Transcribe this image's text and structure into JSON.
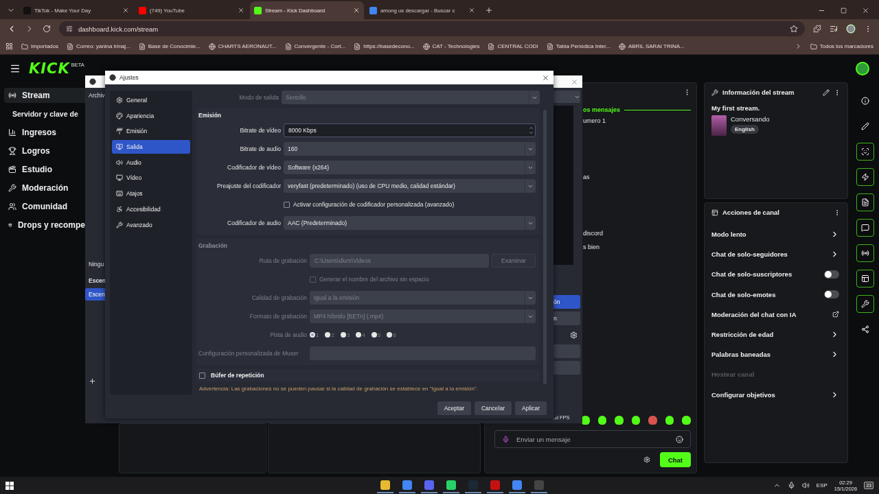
{
  "browser": {
    "tabs": [
      {
        "title": "TikTok - Make Your Day",
        "selected": false
      },
      {
        "title": "(749) YouTube",
        "selected": false
      },
      {
        "title": "Stream - Kick Dashboard",
        "selected": true
      },
      {
        "title": "among us descargar - Buscar c",
        "selected": false
      }
    ],
    "url": "dashboard.kick.com/stream",
    "bookmarks": [
      "Importados",
      "Correo: yanina trinaj...",
      "Base de Conocimie...",
      "CHARTS AERONAUT...",
      "Convergente - Cort...",
      "https://basedecono...",
      "CAT - Technologies",
      "CENTRAL CODI",
      "Tabla Periódica Inter...",
      "ABRIL SARAI TRINA..."
    ],
    "all_bookmarks": "Todos los marcadores"
  },
  "kick": {
    "logo": "KICK",
    "logo_badge": "BETA",
    "nav": [
      {
        "label": "Stream",
        "kind": "main",
        "selected": true
      },
      {
        "label": "Servidor y clave de",
        "kind": "sub",
        "selected": false
      },
      {
        "label": "Ingresos",
        "kind": "main",
        "selected": false
      },
      {
        "label": "Logros",
        "kind": "main",
        "selected": false
      },
      {
        "label": "Estudio",
        "kind": "main",
        "selected": false
      },
      {
        "label": "Moderación",
        "kind": "main",
        "selected": false
      },
      {
        "label": "Comunidad",
        "kind": "main",
        "selected": false
      },
      {
        "label": "Drops y recompe",
        "kind": "main",
        "selected": false
      }
    ],
    "chat": {
      "divider": "os mensajes",
      "messages": [
        "umero 1",
        "as",
        "discord",
        "s bien"
      ],
      "placeholder": "Enviar un mensaje",
      "send": "Chat"
    },
    "stream_info": {
      "title": "Información del stream",
      "stream_title": "My first stream.",
      "category": "Conversando",
      "tag": "English"
    },
    "channel_actions": {
      "title": "Acciones de canal",
      "items": [
        {
          "label": "Modo lento",
          "kind": "link",
          "disabled": false
        },
        {
          "label": "Chat de solo-seguidores",
          "kind": "link",
          "disabled": false
        },
        {
          "label": "Chat de solo-suscriptores",
          "kind": "toggle",
          "on": false,
          "disabled": false
        },
        {
          "label": "Chat de solo-emotes",
          "kind": "toggle",
          "on": false,
          "disabled": false
        },
        {
          "label": "Moderación del chat con IA",
          "kind": "external",
          "disabled": false
        },
        {
          "label": "Restricción de edad",
          "kind": "link",
          "disabled": false
        },
        {
          "label": "Palabras baneadas",
          "kind": "link",
          "disabled": false
        },
        {
          "label": "Hostear canal",
          "kind": "plain",
          "disabled": true
        },
        {
          "label": "Configurar objetivos",
          "kind": "link",
          "disabled": false
        }
      ]
    }
  },
  "obs_window": {
    "menu": "Archiv",
    "sources_hint": "Ningu",
    "scenes_header": "Escen",
    "scenes": [
      {
        "label": "Escen",
        "selected": true
      }
    ],
    "controls": [
      {
        "label": "ón",
        "selected": true
      },
      {
        "label": "n",
        "selected": false
      }
    ],
    "status": "FPS"
  },
  "settings": {
    "title": "Ajustes",
    "categories": [
      {
        "label": "General",
        "selected": false
      },
      {
        "label": "Apariencia",
        "selected": false
      },
      {
        "label": "Emisión",
        "selected": false
      },
      {
        "label": "Salida",
        "selected": true
      },
      {
        "label": "Audio",
        "selected": false
      },
      {
        "label": "Vídeo",
        "selected": false
      },
      {
        "label": "Atajos",
        "selected": false
      },
      {
        "label": "Accesibilidad",
        "selected": false
      },
      {
        "label": "Avanzado",
        "selected": false
      }
    ],
    "output_mode": {
      "label": "Modo de salida",
      "value": "Sencillo"
    },
    "streaming": {
      "title": "Emisión",
      "disabled": false,
      "fields": [
        {
          "kind": "spin",
          "label": "Bitrate de vídeo",
          "value": "8000 Kbps"
        },
        {
          "kind": "select",
          "label": "Bitrate de audio",
          "value": "160"
        },
        {
          "kind": "select",
          "label": "Codificador de vídeo",
          "value": "Software (x264)"
        },
        {
          "kind": "select",
          "label": "Preajuste del codificador",
          "value": "veryfast (predeterminado) (uso de CPU medio, calidad estándar)"
        },
        {
          "kind": "checkbox",
          "label": "Activar configuración de codificador personalizada (avanzado)",
          "checked": false
        },
        {
          "kind": "select",
          "label": "Codificador de audio",
          "value": "AAC (Predeterminado)"
        }
      ]
    },
    "recording": {
      "title": "Grabación",
      "disabled": true,
      "fields": [
        {
          "kind": "path",
          "label": "Ruta de grabación",
          "value": "C:\\Users\\diurs\\Videos",
          "button": "Examinar"
        },
        {
          "kind": "checkbox",
          "label": "Generar el nombre del archivo sin espacio",
          "checked": false
        },
        {
          "kind": "select",
          "label": "Calidad de grabación",
          "value": "Igual a la emisión"
        },
        {
          "kind": "select",
          "label": "Formato de grabación",
          "value": "MP4 híbrido [BETA] (.mp4)"
        },
        {
          "kind": "radio",
          "label": "Pista de audio",
          "options": [
            {
              "label": "1",
              "selected": true
            },
            {
              "label": "2",
              "selected": false
            },
            {
              "label": "3",
              "selected": false
            },
            {
              "label": "4",
              "selected": false
            },
            {
              "label": "5",
              "selected": false
            },
            {
              "label": "6",
              "selected": false
            }
          ]
        },
        {
          "kind": "text",
          "label": "Configuración personalizada de Muxer"
        }
      ]
    },
    "replay_buffer": {
      "label": "Búfer de repetición",
      "checked": false
    },
    "warning": "Advertencia: Las grabaciones no se pueden pausar si la calidad de grabación se establece en \"Igual a la emisión\".",
    "buttons": [
      "Aceptar",
      "Cancelar",
      "Aplicar"
    ]
  },
  "taskbar": {
    "language": "ESP",
    "time": "02:29",
    "date": "15/1/2026",
    "notifications": "23"
  }
}
